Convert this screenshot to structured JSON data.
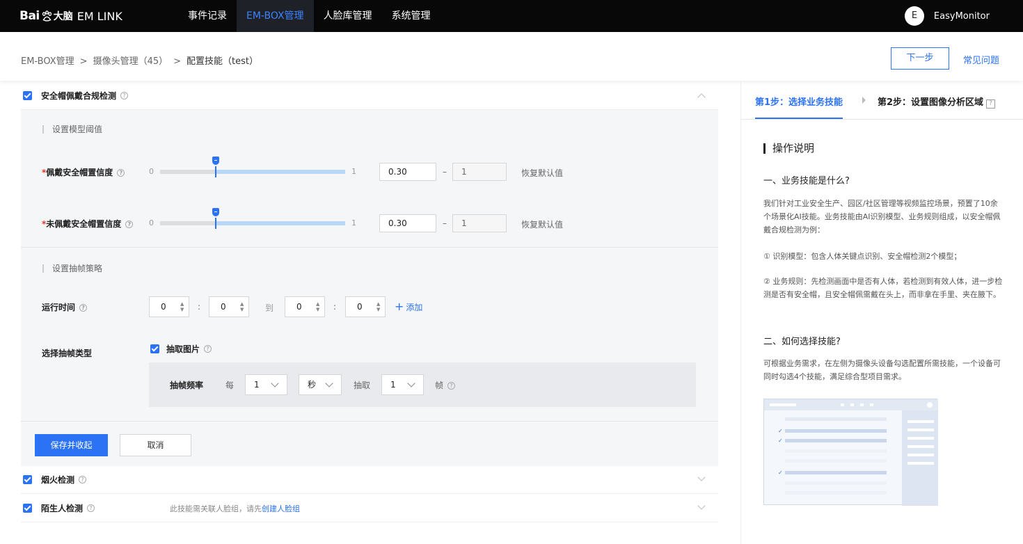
{
  "header": {
    "logo_bai": "Bai",
    "logo_dn": "大脑",
    "logo_app": "EM LINK",
    "nav": [
      "事件记录",
      "EM-BOX管理",
      "人脸库管理",
      "系统管理"
    ],
    "active_nav_index": 1,
    "user_initial": "E",
    "user_name": "EasyMonitor"
  },
  "subheader": {
    "breadcrumb": [
      "EM-BOX管理",
      "摄像头管理（45）",
      "配置技能（test）"
    ],
    "separator": ">",
    "next_button": "下一步",
    "faq": "常见问题"
  },
  "skills": [
    {
      "name": "安全帽佩戴合规检测",
      "checked": true,
      "expanded": true,
      "note": ""
    },
    {
      "name": "烟火检测",
      "checked": true,
      "expanded": false,
      "note": ""
    },
    {
      "name": "陌生人检测",
      "checked": true,
      "expanded": false,
      "note": "此技能需关联人脸组，请先",
      "note_link": "创建人脸组"
    }
  ],
  "model_section": {
    "title": "设置模型阈值",
    "rows": [
      {
        "label": "佩戴安全帽置信度",
        "min_label": "0",
        "max_label": "1",
        "value": "0.30",
        "upper": "1",
        "value_fraction": 0.3,
        "reset": "恢复默认值"
      },
      {
        "label": "未佩戴安全帽置信度",
        "min_label": "0",
        "max_label": "1",
        "value": "0.30",
        "upper": "1",
        "value_fraction": 0.3,
        "reset": "恢复默认值"
      }
    ],
    "dash": "–"
  },
  "frame_section": {
    "title": "设置抽帧策略",
    "run_time_label": "运行时间",
    "time_values": [
      "0",
      "0",
      "0",
      "0"
    ],
    "colon": ":",
    "to": "到",
    "add": "添加",
    "type_label": "选择抽帧类型",
    "type_option": "抽取图片",
    "freq_label": "抽帧频率",
    "every": "每",
    "every_value": "1",
    "unit": "秒",
    "extract": "抽取",
    "extract_value": "1",
    "frame": "帧"
  },
  "actions": {
    "save": "保存并收起",
    "cancel": "取消"
  },
  "help": {
    "step1": "第1步：选择业务技能",
    "step2": "第2步：设置图像分析区域",
    "step2_icon": "?",
    "heading": "操作说明",
    "q1": "一、业务技能是什么?",
    "p1": "我们针对工业安全生产、园区/社区管理等视频监控场景，预置了10余个场景化AI技能。业务技能由AI识别模型、业务规则组成，以安全帽佩戴合规检测为例：",
    "p2": "① 识别模型：包含人体关键点识别、安全帽检测2个模型；",
    "p3": "② 业务规则：先检测画面中是否有人体，若检测到有效人体，进一步检测是否有安全帽，且安全帽佩需戴在头上，而非拿在手里、夹在腋下。",
    "q2": "二、如何选择技能?",
    "p4": "可根据业务需求，在左侧为摄像头设备勾选配置所需技能，一个设备可同时勾选4个技能，满足综合型项目需求。"
  },
  "colors": {
    "accent": "#2b72f5",
    "topbar": "#080808",
    "required": "#e6352b"
  }
}
